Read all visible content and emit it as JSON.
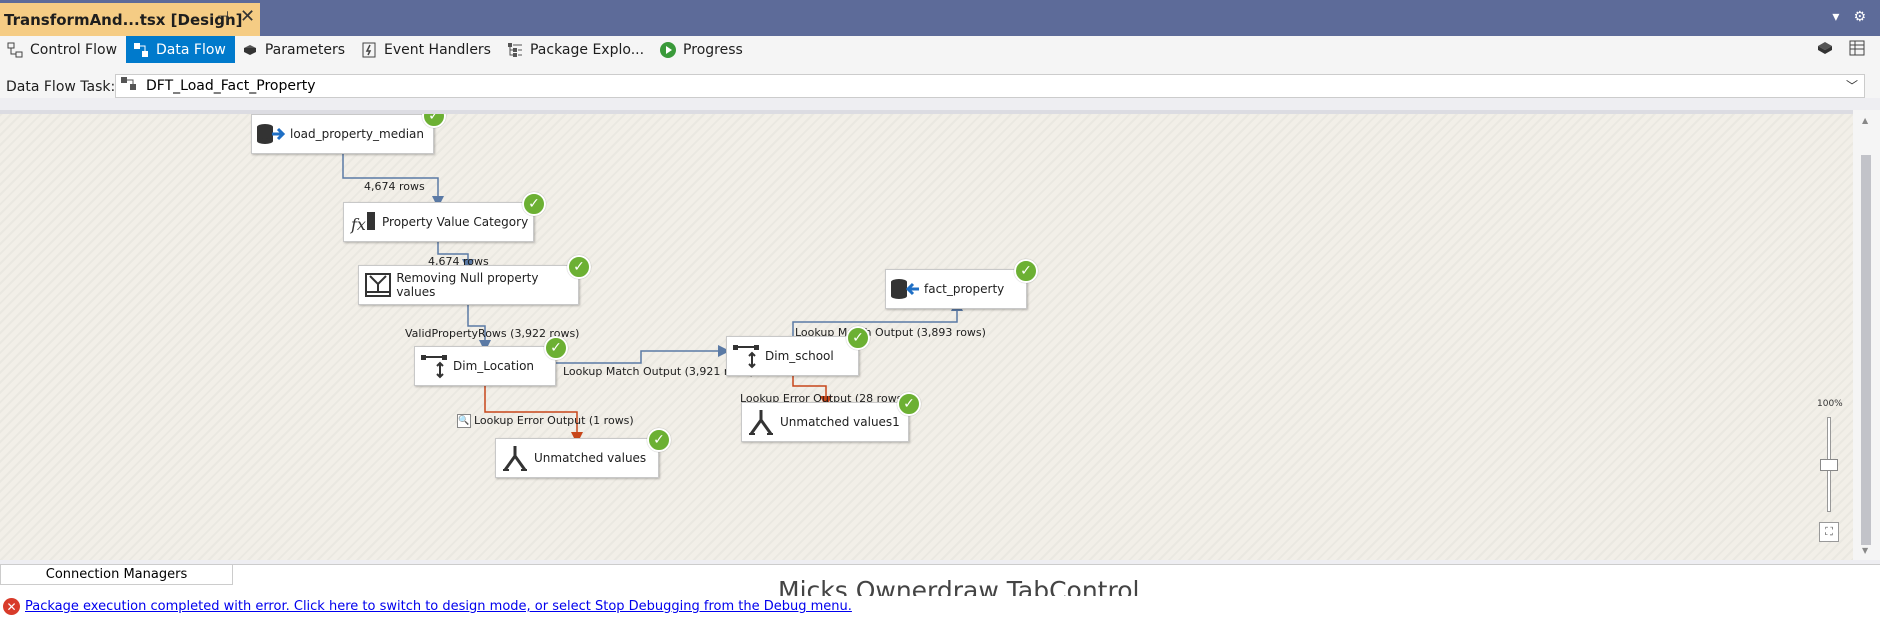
{
  "document_tab": {
    "title": "TransformAnd...tsx [Design]"
  },
  "designer_tabs": [
    {
      "label": "Control Flow",
      "active": false
    },
    {
      "label": "Data Flow",
      "active": true
    },
    {
      "label": "Parameters",
      "active": false
    },
    {
      "label": "Event Handlers",
      "active": false
    },
    {
      "label": "Package Explo...",
      "active": false
    },
    {
      "label": "Progress",
      "active": false
    }
  ],
  "task_selector": {
    "label": "Data Flow Task:",
    "value": "DFT_Load_Fact_Property"
  },
  "nodes": {
    "source": {
      "label": "load_property_median",
      "status": "success"
    },
    "derived": {
      "label": "Property Value Category",
      "status": "success"
    },
    "split": {
      "label": "Removing Null property values",
      "status": "success"
    },
    "lookup_location": {
      "label": "Dim_Location",
      "status": "success"
    },
    "lookup_school": {
      "label": "Dim_school",
      "status": "success"
    },
    "destination": {
      "label": "fact_property",
      "status": "success"
    },
    "unmatched": {
      "label": "Unmatched values",
      "status": "success"
    },
    "unmatched1": {
      "label": "Unmatched values1",
      "status": "success"
    }
  },
  "paths": {
    "p1": "4,674 rows",
    "p2": "4,674 rows",
    "p3": "ValidPropertyRows (3,922 rows)",
    "p4": "Lookup Match Output (3,921 rows)",
    "p5": "Lookup Match Output (3,893 rows)",
    "p6": "Lookup Error Output (1 rows)",
    "p7": "Lookup Error Output (28 rows)"
  },
  "zoom": {
    "level": "100%"
  },
  "bottom": {
    "connection_managers": "Connection Managers",
    "ownerdraw": "Micks Ownerdraw TabControl"
  },
  "status": {
    "message": "Package execution completed with error. Click here to switch to design mode, or select Stop Debugging from the Debug menu."
  },
  "colors": {
    "tab_active": "#007acc",
    "doc_tab": "#f5cc84",
    "success": "#6cb033",
    "error_path": "#c8471a",
    "data_path": "#5b7aa5"
  }
}
